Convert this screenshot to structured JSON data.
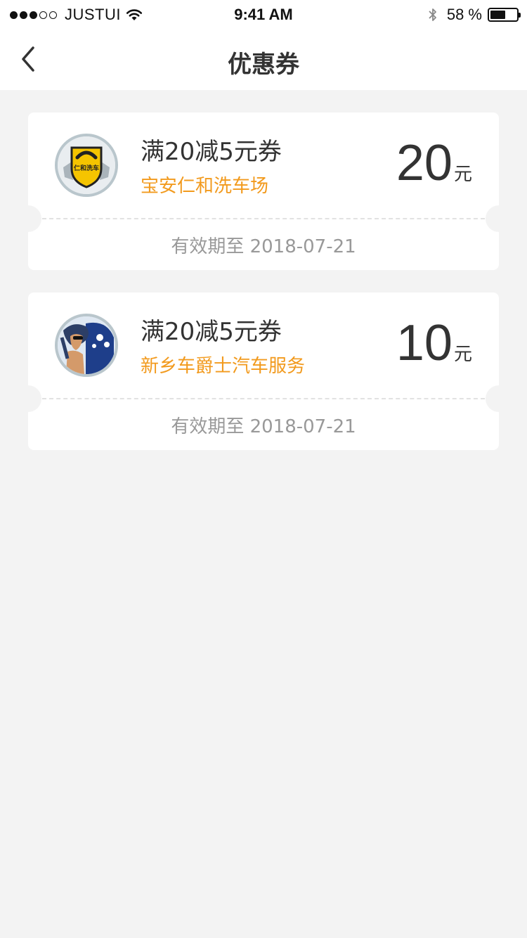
{
  "status_bar": {
    "carrier": "JUSTUI",
    "signal_filled": 3,
    "signal_total": 5,
    "time": "9:41 AM",
    "battery_text": "58 %",
    "battery_level": 0.58
  },
  "nav": {
    "title": "优惠券",
    "back_icon": "chevron-left-icon"
  },
  "coupons": [
    {
      "title": "满20减5元券",
      "merchant": "宝安仁和洗车场",
      "amount": "20",
      "unit": "元",
      "validity": "有效期至 2018-07-21",
      "logo_text": "仁和洗车"
    },
    {
      "title": "满20减5元券",
      "merchant": "新乡车爵士汽车服务",
      "amount": "10",
      "unit": "元",
      "validity": "有效期至 2018-07-21"
    }
  ],
  "colors": {
    "background": "#f3f3f3",
    "card": "#ffffff",
    "accent": "#f29a1d",
    "muted_text": "#999999",
    "primary_text": "#333333"
  }
}
